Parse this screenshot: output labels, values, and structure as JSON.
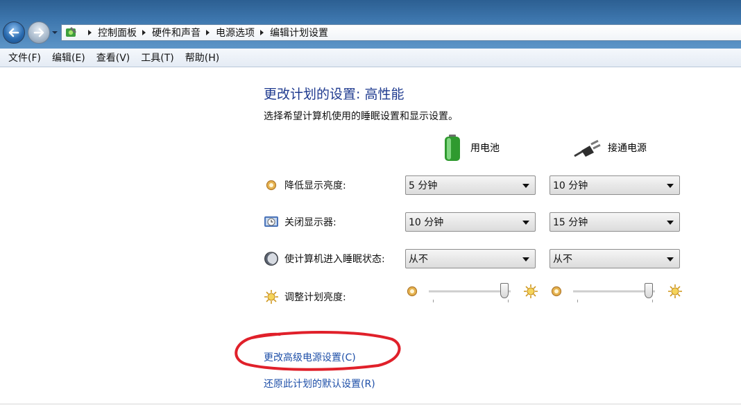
{
  "breadcrumb": [
    "控制面板",
    "硬件和声音",
    "电源选项",
    "编辑计划设置"
  ],
  "menu": [
    "文件(F)",
    "编辑(E)",
    "查看(V)",
    "工具(T)",
    "帮助(H)"
  ],
  "page": {
    "title": "更改计划的设置: 高性能",
    "subtitle": "选择希望计算机使用的睡眠设置和显示设置。"
  },
  "columns": {
    "battery": "用电池",
    "plugged": "接通电源"
  },
  "rows": [
    {
      "label": "降低显示亮度:",
      "battery": "5 分钟",
      "plugged": "10 分钟"
    },
    {
      "label": "关闭显示器:",
      "battery": "10 分钟",
      "plugged": "15 分钟"
    },
    {
      "label": "使计算机进入睡眠状态:",
      "battery": "从不",
      "plugged": "从不"
    }
  ],
  "brightness": {
    "label": "调整计划亮度:",
    "battery_level": 0.92,
    "plugged_level": 0.92
  },
  "links": {
    "advanced": "更改高级电源设置(C)",
    "restore": "还原此计划的默认设置(R)"
  },
  "colors": {
    "title": "#1e3a8f",
    "link": "#1e4fa8",
    "annotation": "#e0202a"
  },
  "icons": [
    "back-arrow-icon",
    "forward-arrow-icon",
    "control-panel-icon",
    "battery-icon",
    "plug-icon",
    "dim-display-icon",
    "monitor-off-icon",
    "sleep-moon-icon",
    "brightness-sun-icon"
  ]
}
